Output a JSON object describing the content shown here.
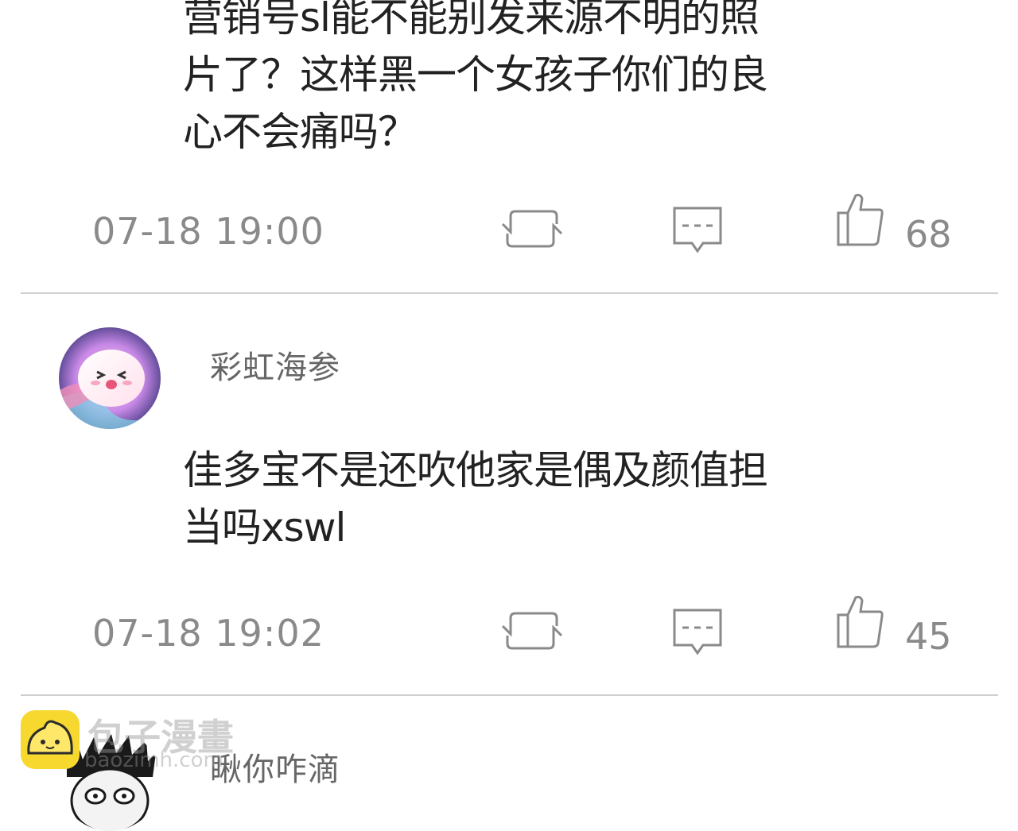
{
  "comments": [
    {
      "text_lines": [
        "营销号sl能不能别发来源不明的照",
        "片了？这样黑一个女孩子你们的良",
        "心不会痛吗？"
      ],
      "timestamp": "07-18  19:00",
      "likes": "68"
    },
    {
      "username": "彩虹海参",
      "text_lines": [
        "佳多宝不是还吹他家是偶及颜值担",
        "当吗xswl"
      ],
      "timestamp": "07-18  19:02",
      "likes": "45"
    },
    {
      "username": "瞅你咋滴"
    }
  ],
  "watermark": {
    "brand": "包子漫畫",
    "url": "baozimh.com"
  },
  "icons": {
    "repost": "repost-icon",
    "comment": "comment-icon",
    "like": "thumbs-up-icon"
  },
  "colors": {
    "text": "#222222",
    "meta": "#8a8a8a",
    "divider": "#cfcfcf",
    "watermark_yellow": "#f7d82f"
  }
}
